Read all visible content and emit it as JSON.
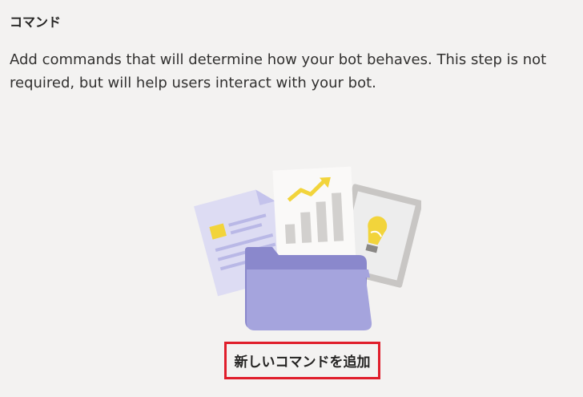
{
  "section": {
    "title": "コマンド",
    "description": "Add commands that will determine how your bot behaves. This step is not required, but will help users interact with your bot."
  },
  "illustration": {
    "icon": "folder-with-documents-illustration"
  },
  "actions": {
    "add_command_label": "新しいコマンドを追加"
  },
  "colors": {
    "highlight_border": "#e01e2b",
    "folder": "#a5a4dd",
    "chart_arrow": "#f2d43b",
    "bulb": "#f2d43b"
  }
}
